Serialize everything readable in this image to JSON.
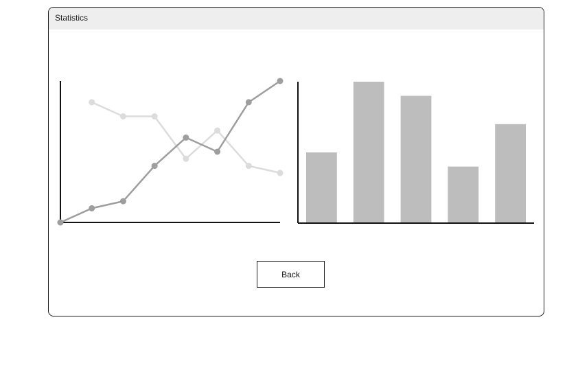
{
  "window": {
    "title": "Statistics"
  },
  "actions": {
    "back_label": "Back"
  },
  "colors": {
    "axis": "#111111",
    "series_dark": "#9e9e9e",
    "series_light": "#dcdcdc",
    "bar": "#bdbdbd"
  },
  "chart_data": [
    {
      "type": "line",
      "title": "",
      "xlabel": "",
      "ylabel": "",
      "x": [
        1,
        2,
        3,
        4,
        5,
        6,
        7,
        8
      ],
      "ylim": [
        0,
        100
      ],
      "grid": false,
      "series": [
        {
          "color": "#9e9e9e",
          "values": [
            0,
            10,
            15,
            40,
            60,
            50,
            85,
            100
          ]
        },
        {
          "color": "#dcdcdc",
          "values": [
            null,
            85,
            75,
            75,
            45,
            65,
            40,
            35
          ]
        }
      ]
    },
    {
      "type": "bar",
      "title": "",
      "xlabel": "",
      "ylabel": "",
      "categories": [
        "",
        "",
        "",
        "",
        ""
      ],
      "values": [
        50,
        100,
        90,
        40,
        70
      ],
      "ylim": [
        0,
        100
      ],
      "grid": false
    }
  ]
}
